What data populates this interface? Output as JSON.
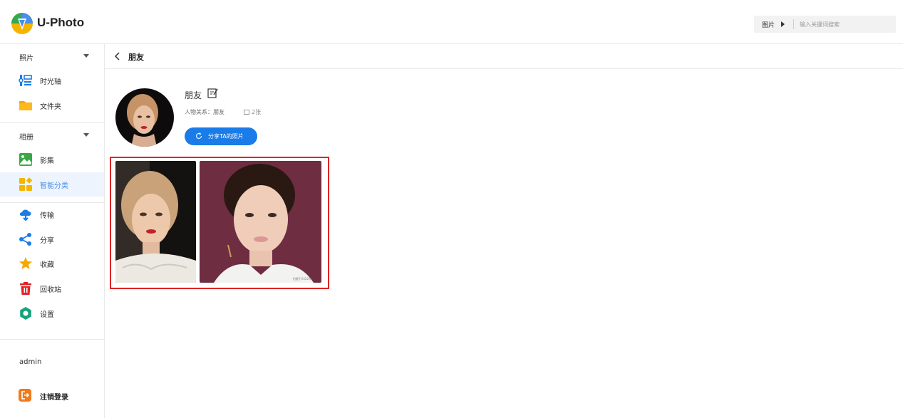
{
  "app": {
    "title": "U-Photo"
  },
  "search": {
    "category": "图片",
    "placeholder": "输入关键词搜索"
  },
  "sidebar": {
    "sections": [
      {
        "label": "照片",
        "items": [
          {
            "label": "时光轴",
            "icon": "timeline-icon"
          },
          {
            "label": "文件夹",
            "icon": "folder-icon"
          }
        ]
      },
      {
        "label": "相册",
        "items": [
          {
            "label": "影集",
            "icon": "album-icon"
          },
          {
            "label": "智能分类",
            "icon": "smart-category-icon",
            "active": true
          }
        ]
      }
    ],
    "tools": [
      {
        "label": "传输",
        "icon": "transfer-icon"
      },
      {
        "label": "分享",
        "icon": "share-icon"
      },
      {
        "label": "收藏",
        "icon": "star-icon"
      },
      {
        "label": "回收站",
        "icon": "trash-icon"
      },
      {
        "label": "设置",
        "icon": "settings-icon"
      }
    ],
    "user": "admin",
    "logout": "注销登录"
  },
  "breadcrumb": {
    "title": "朋友"
  },
  "person": {
    "name": "朋友",
    "relation": "人物关系：朋友",
    "count": "2张",
    "share_button": "分享TA的照片"
  },
  "photos": [
    {
      "name": "photo-blonde-woman"
    },
    {
      "name": "photo-dark-hair-woman",
      "watermark": "拍摄于2022年"
    }
  ],
  "colors": {
    "accent": "#1a7ce8",
    "active_bg": "#eef4fd",
    "active_text": "#4a8ee8",
    "highlight": "#e02424"
  }
}
